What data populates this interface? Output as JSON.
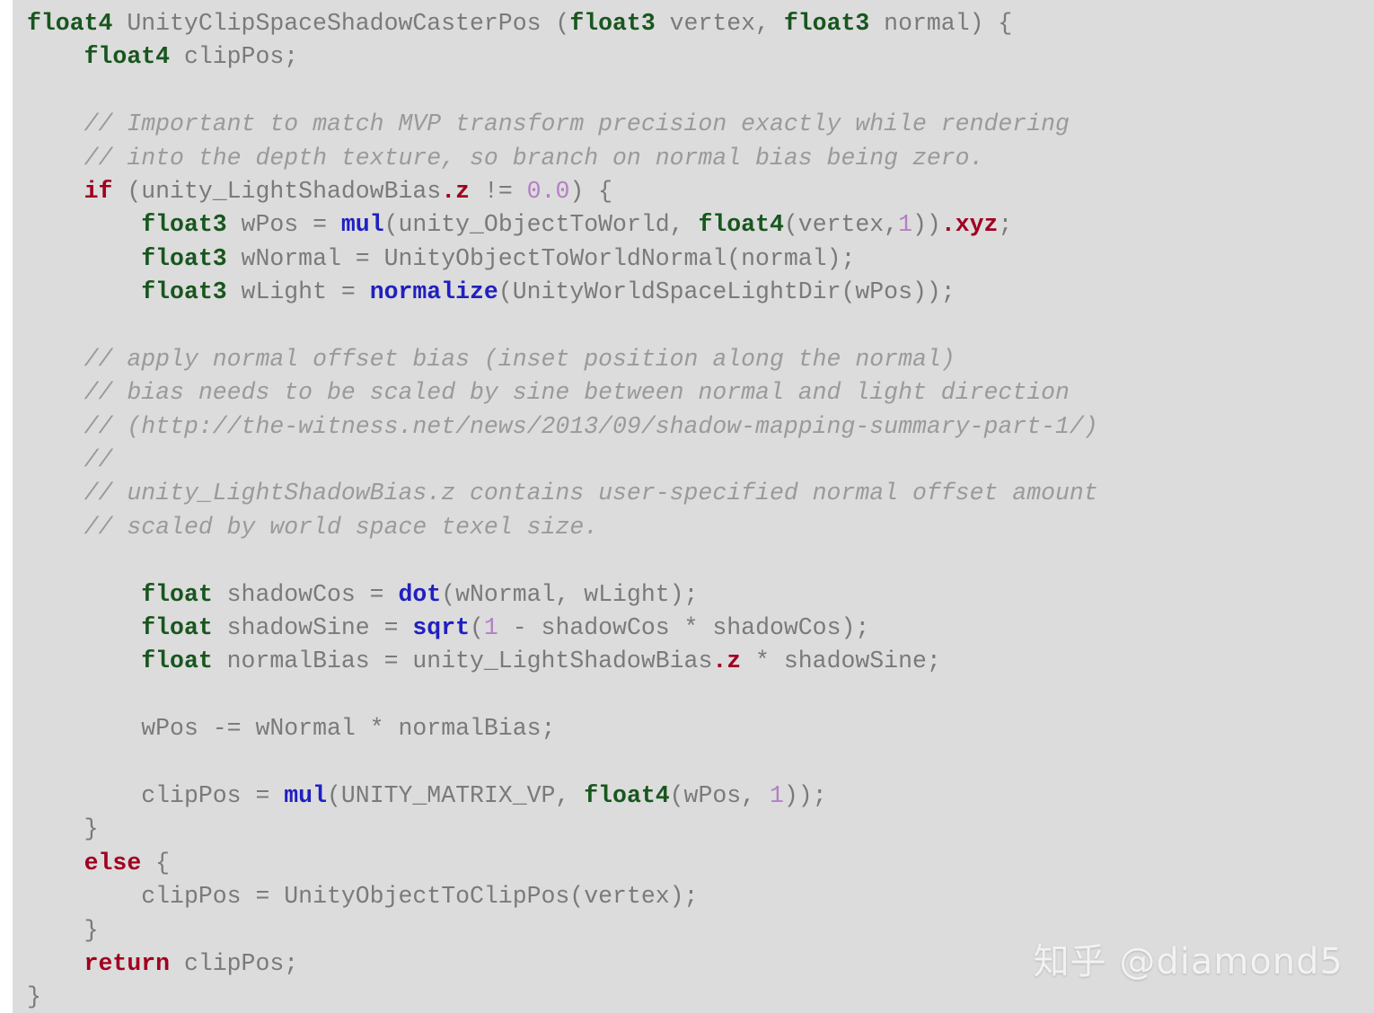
{
  "panel": {
    "background_color": "#dcdcdc",
    "page_background_color": "#ffffff",
    "language": "HLSL / ShaderLab (Unity CGINC)"
  },
  "colors": {
    "type_keyword": "#18561e",
    "control_keyword": "#a00020",
    "builtin_function": "#2020c0",
    "swizzle": "#a00020",
    "number_literal": "#b47fc4",
    "identifier": "#7a7a7a",
    "comment": "#9a9a9a",
    "watermark": "#f2f2f2"
  },
  "watermark": {
    "text": "知乎 @diamond5"
  },
  "code": {
    "line_01": {
      "t1": "float4",
      "t2": " UnityClipSpaceShadowCasterPos (",
      "t3": "float3",
      "t4": " vertex, ",
      "t5": "float3",
      "t6": " normal) {"
    },
    "line_02": {
      "indent": "    ",
      "t1": "float4",
      "t2": " clipPos;"
    },
    "line_03": {
      "text": ""
    },
    "line_04": {
      "indent": "    ",
      "comment": "// Important to match MVP transform precision exactly while rendering"
    },
    "line_05": {
      "indent": "    ",
      "comment": "// into the depth texture, so branch on normal bias being zero."
    },
    "line_06": {
      "indent": "    ",
      "t1": "if",
      "t2": " (unity_LightShadowBias",
      "t3": ".z",
      "t4": " != ",
      "t5": "0.0",
      "t6": ") {"
    },
    "line_07": {
      "indent": "        ",
      "t1": "float3",
      "t2": " wPos = ",
      "t3": "mul",
      "t4": "(unity_ObjectToWorld, ",
      "t5": "float4",
      "t6": "(vertex,",
      "t7": "1",
      "t8": "))",
      "t9": ".xyz",
      "t10": ";"
    },
    "line_08": {
      "indent": "        ",
      "t1": "float3",
      "t2": " wNormal = UnityObjectToWorldNormal(normal);"
    },
    "line_09": {
      "indent": "        ",
      "t1": "float3",
      "t2": " wLight = ",
      "t3": "normalize",
      "t4": "(UnityWorldSpaceLightDir(wPos));"
    },
    "line_10": {
      "text": ""
    },
    "line_11": {
      "indent": "    ",
      "comment": "// apply normal offset bias (inset position along the normal)"
    },
    "line_12": {
      "indent": "    ",
      "comment": "// bias needs to be scaled by sine between normal and light direction"
    },
    "line_13": {
      "indent": "    ",
      "comment": "// (http://the-witness.net/news/2013/09/shadow-mapping-summary-part-1/)"
    },
    "line_14": {
      "indent": "    ",
      "comment": "//"
    },
    "line_15": {
      "indent": "    ",
      "comment": "// unity_LightShadowBias.z contains user-specified normal offset amount"
    },
    "line_16": {
      "indent": "    ",
      "comment": "// scaled by world space texel size."
    },
    "line_17": {
      "text": ""
    },
    "line_18": {
      "indent": "        ",
      "t1": "float",
      "t2": " shadowCos = ",
      "t3": "dot",
      "t4": "(wNormal, wLight);"
    },
    "line_19": {
      "indent": "        ",
      "t1": "float",
      "t2": " shadowSine = ",
      "t3": "sqrt",
      "t4": "(",
      "t5": "1",
      "t6": " - shadowCos * shadowCos);"
    },
    "line_20": {
      "indent": "        ",
      "t1": "float",
      "t2": " normalBias = unity_LightShadowBias",
      "t3": ".z",
      "t4": " * shadowSine;"
    },
    "line_21": {
      "text": ""
    },
    "line_22": {
      "indent": "        ",
      "t1": "wPos -= wNormal * normalBias;"
    },
    "line_23": {
      "text": ""
    },
    "line_24": {
      "indent": "        ",
      "t1": "clipPos = ",
      "t2": "mul",
      "t3": "(UNITY_MATRIX_VP, ",
      "t4": "float4",
      "t5": "(wPos, ",
      "t6": "1",
      "t7": "));"
    },
    "line_25": {
      "indent": "    ",
      "t1": "}"
    },
    "line_26": {
      "indent": "    ",
      "t1": "else",
      "t2": " {"
    },
    "line_27": {
      "indent": "        ",
      "t1": "clipPos = UnityObjectToClipPos(vertex);"
    },
    "line_28": {
      "indent": "    ",
      "t1": "}"
    },
    "line_29": {
      "indent": "    ",
      "t1": "return",
      "t2": " clipPos;"
    },
    "line_30": {
      "t1": "}"
    }
  }
}
